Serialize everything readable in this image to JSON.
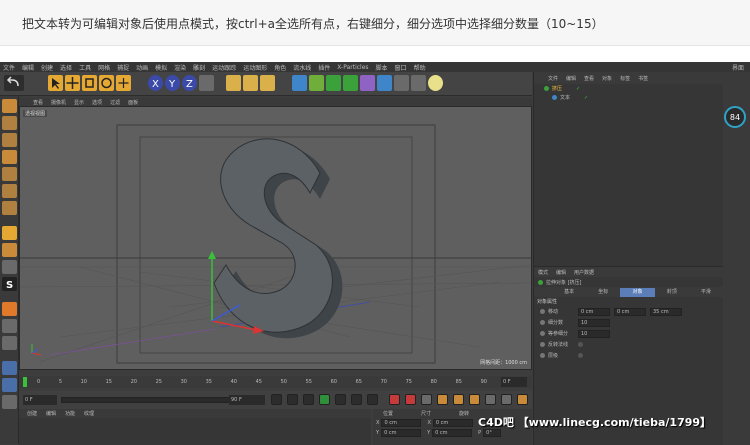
{
  "caption": "把文本转为可编辑对象后使用点模式，按ctrl+a全选所有点，右键细分，细分选项中选择细分数量（10~15）",
  "menubar": {
    "items": [
      "文件",
      "编辑",
      "创建",
      "选择",
      "工具",
      "网格",
      "捕捉",
      "动画",
      "模拟",
      "渲染",
      "雕刻",
      "运动跟踪",
      "运动图形",
      "角色",
      "流水线",
      "插件",
      "X-Particles",
      "脚本",
      "窗口",
      "帮助"
    ],
    "right": "界面"
  },
  "viewport": {
    "menu": [
      "查看",
      "摄像机",
      "显示",
      "选项",
      "过滤",
      "面板"
    ],
    "label": "透视视图",
    "grid": "网格间距：1000 cm",
    "object_letter": "S"
  },
  "timeline": {
    "ticks": [
      "0",
      "5",
      "10",
      "15",
      "20",
      "25",
      "30",
      "35",
      "40",
      "45",
      "50",
      "55",
      "60",
      "65",
      "70",
      "75",
      "80",
      "85",
      "90"
    ],
    "frame_field": "0 F",
    "start_field": "0 F",
    "end_field": "90 F"
  },
  "bottom_left_menu": [
    "创建",
    "编辑",
    "功能",
    "纹理"
  ],
  "coords": {
    "headers": [
      "位置",
      "尺寸",
      "旋转"
    ],
    "rows": [
      {
        "axis": "X",
        "pos": "0 cm",
        "size": "0 cm",
        "rot_axis": "H",
        "rot": "0°"
      },
      {
        "axis": "Y",
        "pos": "0 cm",
        "size": "0 cm",
        "rot_axis": "P",
        "rot": "0°"
      }
    ]
  },
  "object_manager": {
    "menu": [
      "文件",
      "编辑",
      "查看",
      "对象",
      "标签",
      "书签"
    ],
    "items": [
      "挤压",
      "文本"
    ]
  },
  "gauge": {
    "value": "84"
  },
  "attributes": {
    "menu": [
      "模式",
      "编辑",
      "用户数据"
    ],
    "title": "拉伸对象 [挤压]",
    "tabs": [
      "基本",
      "坐标",
      "对象",
      "封顶",
      "平滑"
    ],
    "active_tab": "对象",
    "section": "对象属性",
    "fields": [
      {
        "label": "移动",
        "values": [
          "0 cm",
          "0 cm",
          "35 cm"
        ]
      },
      {
        "label": "细分数",
        "values": [
          "10"
        ]
      },
      {
        "label": "等参细分",
        "values": [
          "10"
        ]
      },
      {
        "label": "反转法线",
        "values": []
      },
      {
        "label": "层级",
        "values": []
      }
    ]
  },
  "watermark": "C4D吧 【www.linecg.com/tieba/1799】",
  "colors": {
    "accent": "#5b7db8",
    "viewport_bg": "#5f5f5f",
    "gauge_ring": "#2fa3c7"
  }
}
